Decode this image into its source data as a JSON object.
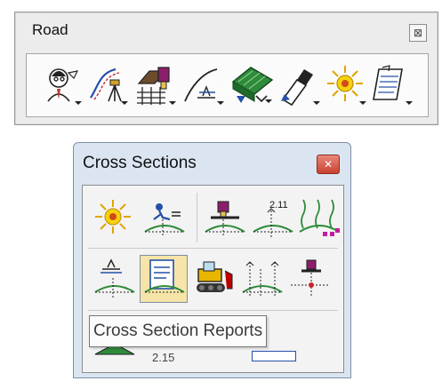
{
  "road_toolbar": {
    "title": "Road",
    "close_glyph": "⊠",
    "tools": [
      {
        "icon": "surveyor-person-icon"
      },
      {
        "icon": "alignment-tripod-icon"
      },
      {
        "icon": "paint-roller-grid-icon"
      },
      {
        "icon": "profile-curve-icon"
      },
      {
        "icon": "green-surface-icon"
      },
      {
        "icon": "pen-drafting-icon"
      },
      {
        "icon": "sun-burst-icon"
      },
      {
        "icon": "notepad-icon"
      }
    ]
  },
  "cross_sections": {
    "title": "Cross Sections",
    "close_glyph": "✕",
    "tooltip": "Cross Section Reports",
    "partial_number_label": "2.15",
    "tools": [
      {
        "icon": "sun-burst-icon"
      },
      {
        "icon": "run-cross-section-icon"
      },
      {
        "icon": "paint-cross-section-icon"
      },
      {
        "icon": "numbered-cross-section-icon",
        "label": "2.11"
      },
      {
        "icon": "colored-cross-section-icon"
      },
      {
        "icon": "design-cross-section-icon"
      },
      {
        "icon": "cross-section-reports-icon"
      },
      {
        "icon": "bulldozer-icon"
      },
      {
        "icon": "offset-cross-section-icon"
      },
      {
        "icon": "target-cross-section-icon"
      },
      {
        "icon": "layer-stack-icon"
      }
    ]
  },
  "colors": {
    "xs_frame": "#dbe5f2",
    "close_red": "#c9412f",
    "selected_highlight": "#f6e4a8",
    "terrain_green": "#2e8b3a",
    "ink_blue": "#2450a8"
  }
}
